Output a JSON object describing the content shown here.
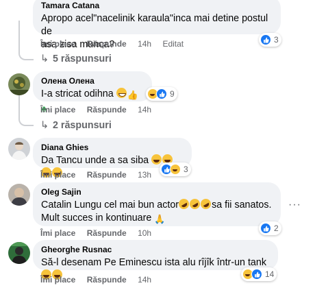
{
  "ui": {
    "like_label": "Îmi place",
    "reply_label": "Răspunde",
    "edited_label": "Editat",
    "more_label": "···"
  },
  "comments": [
    {
      "author": "Tamara Catana",
      "line1": "Apropo acel\"nacelinik karaula\"inca mai detine postul de",
      "line2": "asa zisa munca?",
      "time": "14h",
      "edited": true,
      "reactions": [
        "like"
      ],
      "reaction_count": "3",
      "replies": "5 răspunsuri"
    },
    {
      "author": "Олена Олена",
      "text": "I-a stricat odihna",
      "emojis": [
        "grin",
        "thumb",
        "clover"
      ],
      "time": "14h",
      "reactions": [
        "haha",
        "like"
      ],
      "reaction_count": "9",
      "replies": "2 răspunsuri"
    },
    {
      "author": "Diana Ghies",
      "text": "Da Tancu unde a sa siba",
      "emojis": [
        "laugh",
        "laugh",
        "laugh",
        "laugh"
      ],
      "time": "13h",
      "reactions": [
        "like",
        "haha"
      ],
      "reaction_count": "3"
    },
    {
      "author": "Oleg Sajin",
      "line1": "Catalin Lungu cel mai bun actor",
      "line1_tail": "sa fii sanatos.",
      "line2": "Mult succes in kontinuare",
      "time": "10h",
      "reactions": [
        "like"
      ],
      "reaction_count": "2"
    },
    {
      "author": "Gheorghe Rusnac",
      "text": "Să-l desenam Pe Eminescu ista alu rîjîk într-un tank",
      "time": "14h",
      "reactions": [
        "haha",
        "like"
      ],
      "reaction_count": "14"
    }
  ],
  "colors": {
    "bubble": "#f0f2f5",
    "meta_text": "#65676b",
    "like_blue": "#1877f2",
    "haha_yellow": "#f7c33b"
  }
}
